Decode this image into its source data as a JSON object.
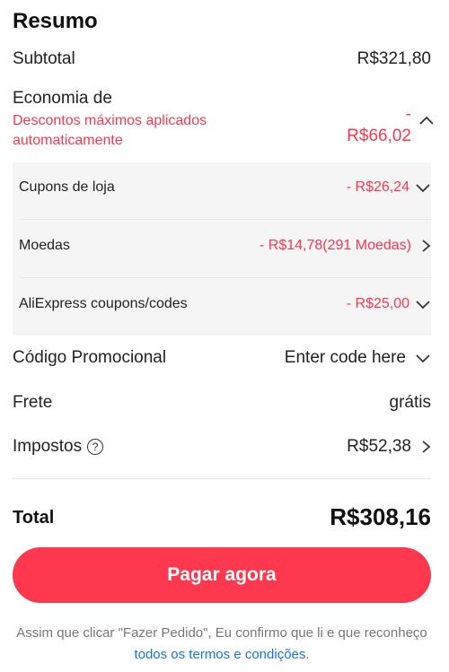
{
  "summary": {
    "title": "Resumo",
    "subtotal_label": "Subtotal",
    "subtotal_value": "R$321,80",
    "savings_label": "Economia de",
    "savings_desc": "Descontos máximos aplicados automaticamente",
    "savings_value_line1": "-",
    "savings_value_line2": "R$66,02",
    "discounts": [
      {
        "label": "Cupons de loja",
        "value": "- R$26,24",
        "chevron": "chevron-down-icon"
      },
      {
        "label": "Moedas",
        "value": "- R$14,78(291 Moedas)",
        "chevron": "chevron-right-icon"
      },
      {
        "label": "AliExpress coupons/codes",
        "value": "- R$25,00",
        "chevron": "chevron-down-icon"
      }
    ],
    "promo_label": "Código Promocional",
    "promo_placeholder": "Enter code here",
    "shipping_label": "Frete",
    "shipping_value": "grátis",
    "tax_label": "Impostos",
    "tax_help": "?",
    "tax_value": "R$52,38",
    "total_label": "Total",
    "total_value": "R$308,16",
    "pay_button": "Pagar agora",
    "footer_text": "Assim que clicar \"Fazer Pedido\", Eu confirmo que li e que reconheço ",
    "footer_link": "todos os termos e condições",
    "footer_end": "."
  },
  "colors": {
    "accent": "#fd384f",
    "link": "#1a73e8",
    "panel_bg": "#f5f5f5"
  }
}
